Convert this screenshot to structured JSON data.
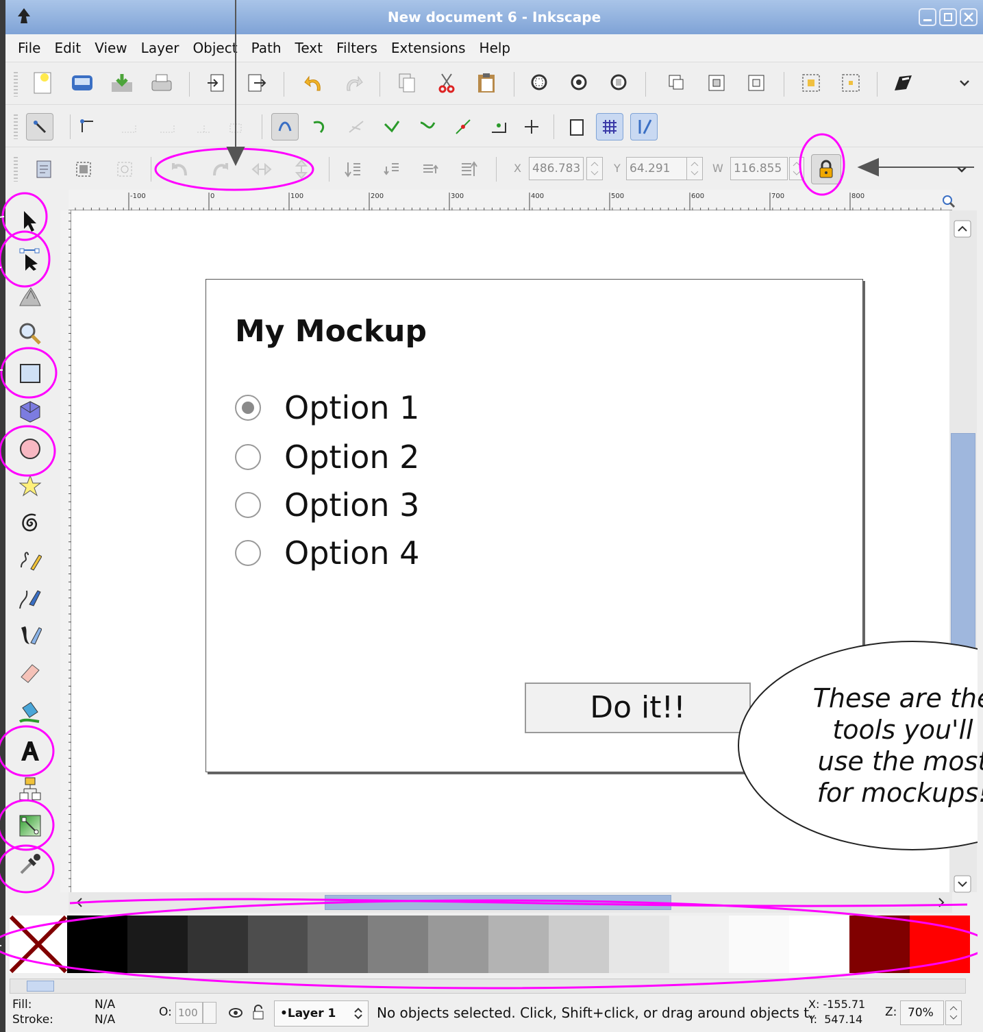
{
  "window": {
    "title": "New document 6 - Inkscape"
  },
  "menu": [
    "File",
    "Edit",
    "View",
    "Layer",
    "Object",
    "Path",
    "Text",
    "Filters",
    "Extensions",
    "Help"
  ],
  "toolbar_coords": {
    "x_label": "X",
    "x_value": "486.783",
    "y_label": "Y",
    "y_value": "64.291",
    "w_label": "W",
    "w_value": "116.855"
  },
  "ruler_labels": [
    "-100",
    "0",
    "100",
    "200",
    "300",
    "400",
    "500",
    "600",
    "700",
    "800"
  ],
  "mockup": {
    "title": "My Mockup",
    "options": [
      "Option 1",
      "Option 2",
      "Option 3",
      "Option 4"
    ],
    "selected": 0,
    "button": "Do it!!"
  },
  "callout": {
    "text": "These are the tools you'll use the most for mockups!"
  },
  "palette": {
    "colors": [
      "#000000",
      "#1a1a1a",
      "#333333",
      "#4d4d4d",
      "#666666",
      "#808080",
      "#999999",
      "#b3b3b3",
      "#cccccc",
      "#e6e6e6",
      "#f2f2f2",
      "#fafafa",
      "#ffffff",
      "#800000",
      "#ff0000"
    ]
  },
  "status": {
    "fill_label": "Fill:",
    "fill_value": "N/A",
    "stroke_label": "Stroke:",
    "stroke_value": "N/A",
    "opacity_label": "O:",
    "opacity_value": "100",
    "layer": "•Layer 1",
    "message": "No objects selected. Click, Shift+click, or drag around objects t.",
    "x_readout": "X: -155.71",
    "y_readout": "Y:  547.14",
    "zoom_label": "Z:",
    "zoom_value": "70%"
  },
  "colors": {
    "annotation": "#ff00ff",
    "accent": "#7fa3d6"
  }
}
